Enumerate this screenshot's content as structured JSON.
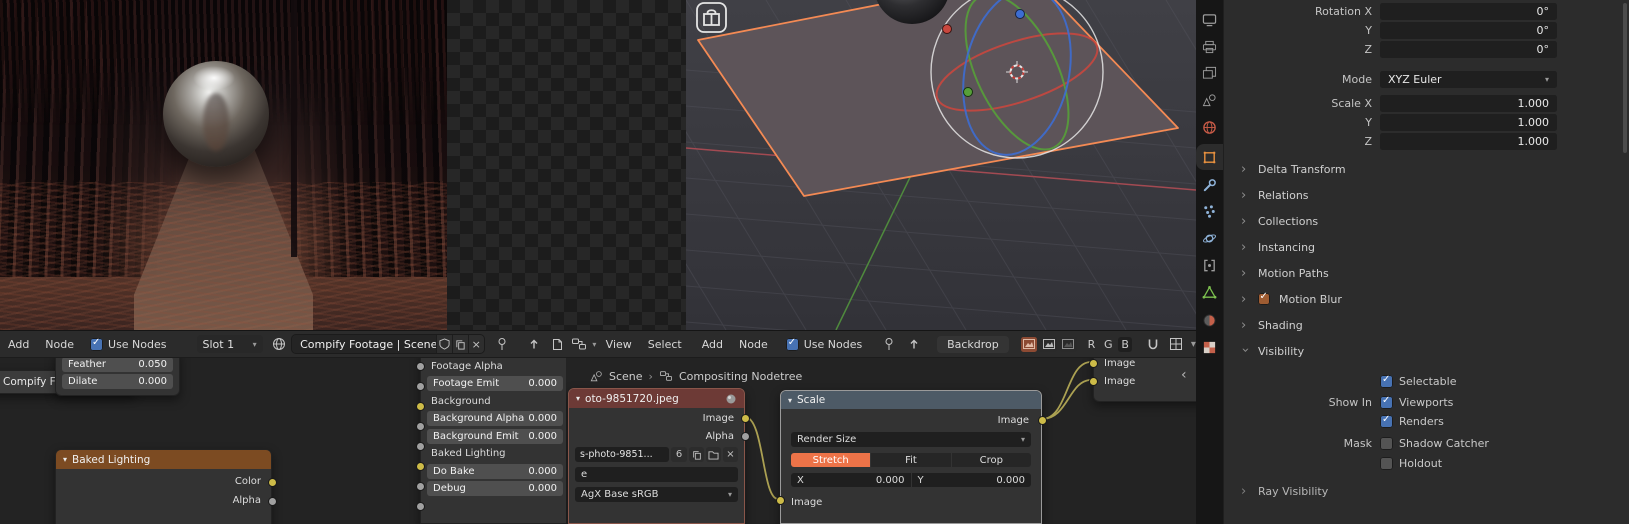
{
  "colors": {
    "accent": "#ed7348",
    "checkbox_blue": "#4772b3",
    "socket_yellow": "#cdbb48",
    "wire_yellow": "#b3a855",
    "selected_outline": "#f48a54",
    "axis_x": "#c8473e",
    "axis_y": "#57a039",
    "axis_z": "#3d6dd2"
  },
  "editor_left": {
    "header": {
      "menu_add": "Add",
      "menu_node": "Node",
      "use_nodes": "Use Nodes",
      "use_nodes_checked": true,
      "slot": "Slot 1",
      "tree_name": "Compify Footage | Scene"
    },
    "feather_node": {
      "fields": [
        {
          "label": "Feather",
          "value": "0.050"
        },
        {
          "label": "Dilate",
          "value": "0.000"
        }
      ]
    },
    "title_node": "Compify Footage | Scene",
    "io_node": {
      "rows": [
        {
          "label": "Footage Alpha",
          "socket": "gray"
        },
        {
          "label": "Footage Emit",
          "value": "0.000",
          "socket": "gray"
        },
        {
          "label": "Background",
          "socket": "yellow"
        },
        {
          "label": "Background Alpha",
          "value": "0.000",
          "socket": "gray"
        },
        {
          "label": "Background Emit",
          "value": "0.000",
          "socket": "gray"
        },
        {
          "label": "Baked Lighting",
          "socket": "yellow"
        },
        {
          "label": "Do Bake",
          "value": "0.000",
          "socket": "gray"
        },
        {
          "label": "Debug",
          "value": "0.000",
          "socket": "gray"
        }
      ]
    },
    "baked_node": {
      "title": "Baked Lighting",
      "out_color": "Color",
      "out_alpha": "Alpha"
    }
  },
  "editor_right": {
    "header": {
      "menu_view": "View",
      "menu_select": "Select",
      "menu_add": "Add",
      "menu_node": "Node",
      "use_nodes": "Use Nodes",
      "use_nodes_checked": true,
      "backdrop": "Backdrop",
      "r": "R",
      "g": "G",
      "b": "B"
    },
    "breadcrumb": {
      "scene": "Scene",
      "separator": "›",
      "tree": "Compositing Nodetree"
    },
    "image_node": {
      "title": "oto-9851720.jpeg",
      "out_image": "Image",
      "out_alpha": "Alpha",
      "filename": "s-photo-9851...",
      "users": "6",
      "source_fragment": "e",
      "colorspace": "AgX Base sRGB"
    },
    "scale_node": {
      "title": "Scale",
      "out_image": "Image",
      "size_mode": "Render Size",
      "stretch": "Stretch",
      "fit": "Fit",
      "crop": "Crop",
      "active_method": "Stretch",
      "x_label": "X",
      "x_value": "0.000",
      "y_label": "Y",
      "y_value": "0.000",
      "in_image": "Image"
    },
    "right_node": {
      "in1": "Image",
      "in2": "Image",
      "collapse_chevron": "‹"
    }
  },
  "properties": {
    "rows": [
      {
        "label": "Rotation X",
        "value": "0°"
      },
      {
        "label": "Y",
        "value": "0°"
      },
      {
        "label": "Z",
        "value": "0°"
      },
      {
        "label": "Mode",
        "value": "XYZ Euler"
      },
      {
        "label": "Scale X",
        "value": "1.000"
      },
      {
        "label": "Y",
        "value": "1.000"
      },
      {
        "label": "Z",
        "value": "1.000"
      }
    ],
    "sections": [
      {
        "label": "Delta Transform",
        "expanded": false
      },
      {
        "label": "Relations",
        "expanded": false
      },
      {
        "label": "Collections",
        "expanded": false
      },
      {
        "label": "Instancing",
        "expanded": false
      },
      {
        "label": "Motion Paths",
        "expanded": false
      },
      {
        "label": "Motion Blur",
        "expanded": false,
        "has_checkbox": true,
        "checkbox_keyed": true
      },
      {
        "label": "Shading",
        "expanded": false
      },
      {
        "label": "Visibility",
        "expanded": true
      },
      {
        "label": "Ray Visibility",
        "expanded": false
      }
    ],
    "visibility": {
      "selectable": "Selectable",
      "selectable_checked": true,
      "show_in": "Show In",
      "viewports": "Viewports",
      "viewports_checked": true,
      "renders": "Renders",
      "renders_checked": true,
      "mask": "Mask",
      "shadow_catcher": "Shadow Catcher",
      "shadow_catcher_checked": false,
      "holdout": "Holdout",
      "holdout_checked": false
    }
  },
  "tab_strip": {
    "active": "object-properties",
    "tabs": [
      "render-properties",
      "output-properties",
      "view-layer-properties",
      "scene-properties",
      "world-properties",
      "object-properties",
      "modifier-properties",
      "particle-properties",
      "physics-properties",
      "constraint-properties",
      "object-data-properties",
      "material-properties",
      "texture-properties"
    ]
  },
  "icons": {
    "checkmark": "✓",
    "close-x": "×",
    "dropdown-arrow": "▾",
    "collapse-chevron": "›",
    "pin": "pin-glyph",
    "globe-browse": "globe-glyph",
    "shield-fake-user": "shield-glyph",
    "duplicate": "copy-pages-glyph",
    "parent-up-arrow": "up-arrow-glyph",
    "page": "page-glyph",
    "magnet-snap": "magnet-glyph",
    "overlay-grid": "grid-glyph",
    "node-editor-type": "linked-boxes-glyph",
    "image-channel": "mountain-photo-glyph",
    "pack": "package-glyph",
    "folder-open": "folder-glyph",
    "preview-sphere": "sphere-glyph"
  }
}
